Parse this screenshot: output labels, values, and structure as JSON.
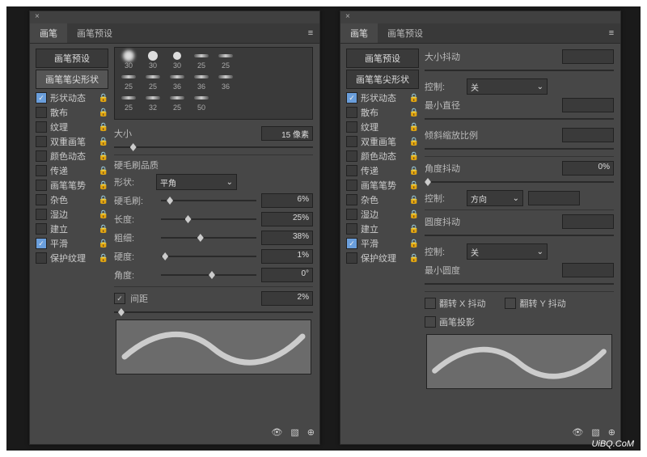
{
  "tabs": {
    "brush": "画笔",
    "preset": "画笔预设"
  },
  "sidebar": {
    "presetBtn": "画笔预设",
    "tipBtn": "画笔笔尖形状",
    "items": [
      {
        "label": "形状动态",
        "on": true
      },
      {
        "label": "散布",
        "on": false
      },
      {
        "label": "纹理",
        "on": false
      },
      {
        "label": "双重画笔",
        "on": false
      },
      {
        "label": "颜色动态",
        "on": false
      },
      {
        "label": "传递",
        "on": false
      },
      {
        "label": "画笔笔势",
        "on": false
      },
      {
        "label": "杂色",
        "on": false
      },
      {
        "label": "湿边",
        "on": false
      },
      {
        "label": "建立",
        "on": false
      },
      {
        "label": "平滑",
        "on": true
      },
      {
        "label": "保护纹理",
        "on": false
      }
    ]
  },
  "left": {
    "presetNums": [
      "30",
      "30",
      "30",
      "25",
      "25",
      "25",
      "25",
      "36",
      "36",
      "36",
      "25",
      "32",
      "25",
      "50"
    ],
    "sizeLabel": "大小",
    "sizeValue": "15 像素",
    "bristleSection": "硬毛刷品质",
    "shapeLabel": "形状:",
    "shapeValue": "平角",
    "bristleLabel": "硬毛刷:",
    "bristleValue": "6%",
    "lengthLabel": "长度:",
    "lengthValue": "25%",
    "thickLabel": "粗细:",
    "thickValue": "38%",
    "hardLabel": "硬度:",
    "hardValue": "1%",
    "angleLabel": "角度:",
    "angleValue": "0°",
    "spacingLabel": "间距",
    "spacingValue": "2%"
  },
  "right": {
    "sizeJitter": "大小抖动",
    "control": "控制:",
    "controlOff": "关",
    "controlDir": "方向",
    "minDia": "最小直径",
    "tiltScale": "倾斜缩放比例",
    "angleJitter": "角度抖动",
    "angleJitterVal": "0%",
    "roundJitter": "圆度抖动",
    "minRound": "最小圆度",
    "flipX": "翻转 X 抖动",
    "flipY": "翻转 Y 抖动",
    "brushProj": "画笔投影"
  },
  "watermark": "UiBQ.CoM"
}
